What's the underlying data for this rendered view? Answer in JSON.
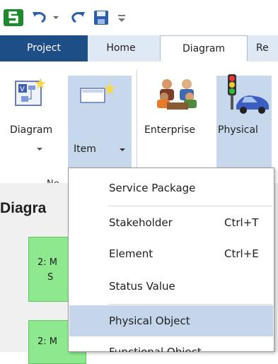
{
  "ribbon_tabs": [
    "Project",
    "Home",
    "Diagram",
    "Re"
  ],
  "ribbon": {
    "diagram_label": "Diagram",
    "item_label": "Item",
    "enterprise_label": "Enterprise",
    "physical_label": "Physical",
    "group_new_label": "Ne"
  },
  "pane": {
    "title": "Diagra",
    "nodes": [
      "2: M",
      "2: M"
    ],
    "node_sub": "S"
  },
  "menu": {
    "items": [
      {
        "label": "Service Package",
        "shortcut": ""
      },
      {
        "label": "Stakeholder",
        "shortcut": "Ctrl+T"
      },
      {
        "label": "Element",
        "shortcut": "Ctrl+E"
      },
      {
        "label": "Status Value",
        "shortcut": ""
      },
      {
        "label": "Physical Object",
        "shortcut": ""
      },
      {
        "label": "Functional Object",
        "shortcut": ""
      }
    ]
  },
  "colors": {
    "project_tab": "#1e4e86",
    "ribbon_bg": "#dfe9f5",
    "highlight": "#c7d8ec",
    "node_green": "#8ee88e"
  }
}
